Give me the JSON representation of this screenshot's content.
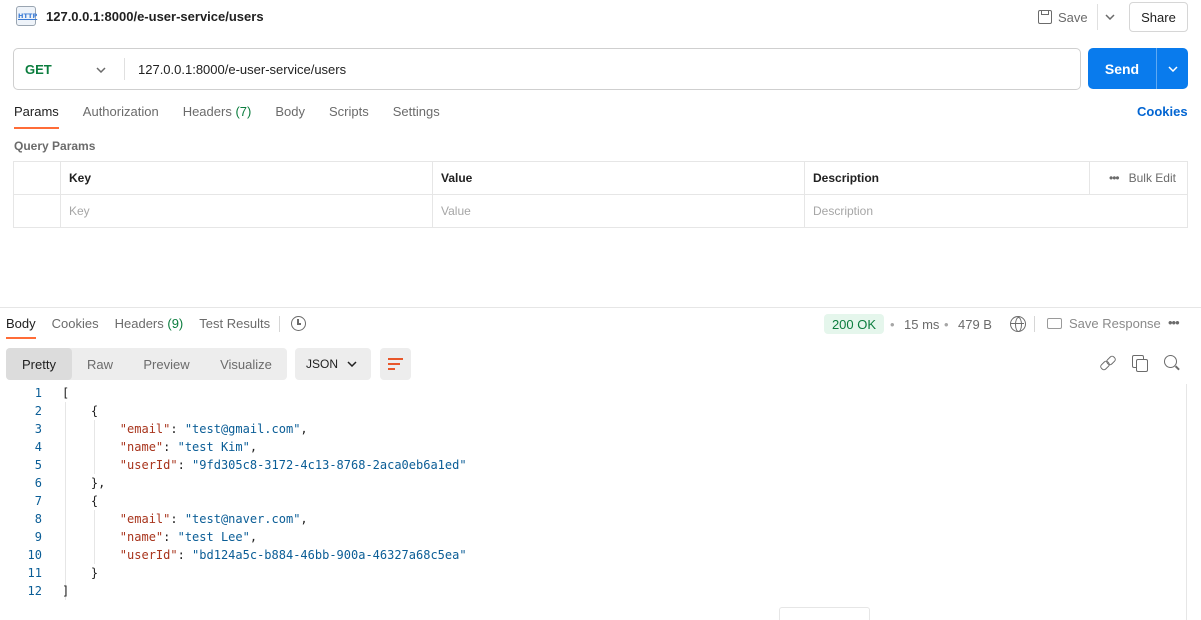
{
  "tab": {
    "title": "127.0.0.1:8000/e-user-service/users",
    "icon": "http-file-icon"
  },
  "header": {
    "save_label": "Save",
    "share_label": "Share"
  },
  "request": {
    "method": "GET",
    "url": "127.0.0.1:8000/e-user-service/users",
    "send_label": "Send",
    "tabs": [
      {
        "label": "Params",
        "active": true
      },
      {
        "label": "Authorization"
      },
      {
        "label": "Headers",
        "count": "(7)"
      },
      {
        "label": "Body"
      },
      {
        "label": "Scripts"
      },
      {
        "label": "Settings"
      }
    ],
    "cookies_label": "Cookies"
  },
  "query_params": {
    "title": "Query Params",
    "headers": {
      "key": "Key",
      "value": "Value",
      "description": "Description",
      "bulk_edit": "Bulk Edit"
    },
    "placeholder_row": {
      "key": "Key",
      "value": "Value",
      "description": "Description"
    }
  },
  "response": {
    "tabs": [
      {
        "label": "Body",
        "active": true
      },
      {
        "label": "Cookies"
      },
      {
        "label": "Headers",
        "count": "(9)"
      },
      {
        "label": "Test Results"
      }
    ],
    "status": "200 OK",
    "time": "15 ms",
    "size": "479 B",
    "save_response_label": "Save Response",
    "views": [
      "Pretty",
      "Raw",
      "Preview",
      "Visualize"
    ],
    "active_view": "Pretty",
    "format": "JSON",
    "body_lines": [
      {
        "n": "1",
        "text": "["
      },
      {
        "n": "2",
        "text": "    {"
      },
      {
        "n": "3",
        "key": "\"email\"",
        "value": "\"test@gmail.com\"",
        "suffix": ","
      },
      {
        "n": "4",
        "key": "\"name\"",
        "value": "\"test Kim\"",
        "suffix": ","
      },
      {
        "n": "5",
        "key": "\"userId\"",
        "value": "\"9fd305c8-3172-4c13-8768-2aca0eb6a1ed\"",
        "suffix": ""
      },
      {
        "n": "6",
        "text": "    },"
      },
      {
        "n": "7",
        "text": "    {"
      },
      {
        "n": "8",
        "key": "\"email\"",
        "value": "\"test@naver.com\"",
        "suffix": ","
      },
      {
        "n": "9",
        "key": "\"name\"",
        "value": "\"test Lee\"",
        "suffix": ","
      },
      {
        "n": "10",
        "key": "\"userId\"",
        "value": "\"bd124a5c-b884-46bb-900a-46327a68c5ea\"",
        "suffix": ""
      },
      {
        "n": "11",
        "text": "    }"
      },
      {
        "n": "12",
        "text": "]"
      }
    ]
  },
  "colors": {
    "accent": "#ff6c37",
    "send": "#097bed",
    "method_get": "#0b7d3e",
    "json_key": "#a8341c",
    "json_string": "#0a5d96"
  }
}
